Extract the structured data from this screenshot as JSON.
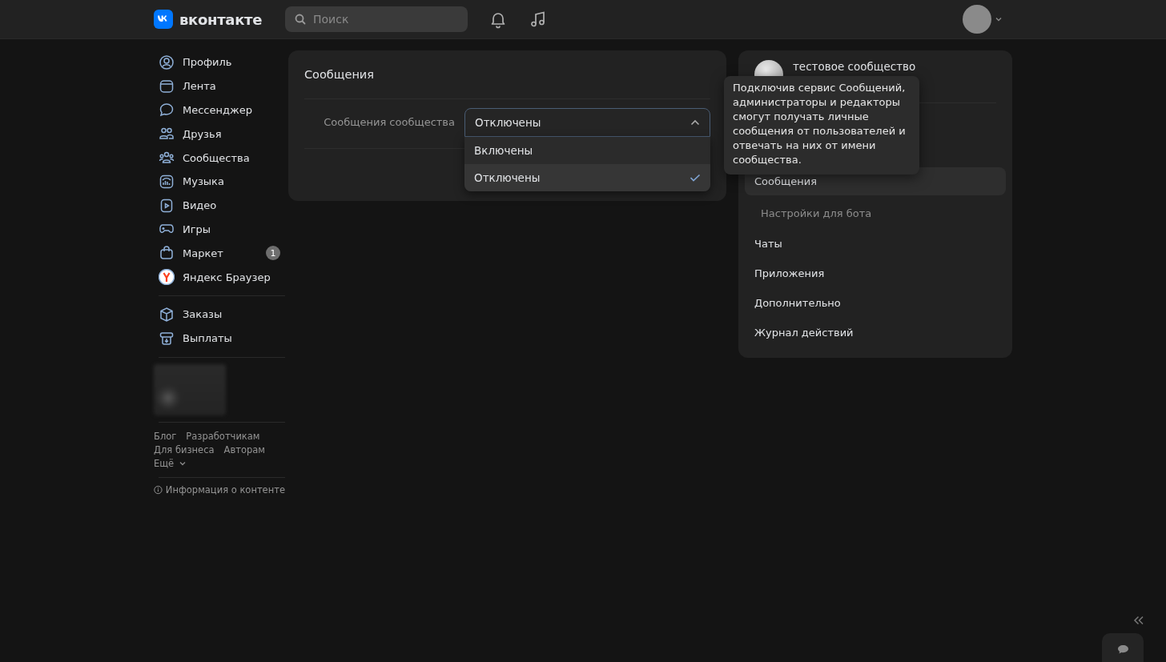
{
  "header": {
    "logo_text": "вконтакте",
    "search": {
      "placeholder": "Поиск"
    }
  },
  "sidebar": {
    "items": [
      {
        "label": "Профиль",
        "selected": false
      },
      {
        "label": "Лента",
        "selected": false
      },
      {
        "label": "Мессенджер",
        "selected": false
      },
      {
        "label": "Друзья",
        "selected": false
      },
      {
        "label": "Сообщества",
        "selected": false
      },
      {
        "label": "Музыка",
        "selected": false
      },
      {
        "label": "Видео",
        "selected": false
      },
      {
        "label": "Игры",
        "selected": false
      },
      {
        "label": "Маркет",
        "selected": false,
        "badge": "1"
      },
      {
        "label": "Яндекс Браузер",
        "selected": false
      }
    ],
    "extra_items": [
      {
        "label": "Заказы"
      },
      {
        "label": "Выплаты"
      }
    ],
    "footer_links": [
      [
        "Блог",
        "Разработчикам"
      ],
      [
        "Для бизнеса",
        "Авторам"
      ],
      [
        "Ещё"
      ]
    ],
    "content_info": "Информация о контенте"
  },
  "settings_card": {
    "title": "Сообщения",
    "field_label": "Сообщения сообщества",
    "select": {
      "value": "Отключены",
      "expanded": true,
      "options": [
        {
          "label": "Включены",
          "selected": false
        },
        {
          "label": "Отключены",
          "selected": true
        }
      ]
    }
  },
  "tooltip": "Подключив сервис Сообщений, администраторы и редакторы смогут получать личные сообщения от пользователей и отвечать на них от имени сообщества.",
  "right_panel": {
    "community_name": "тестовое сообщество",
    "menu": [
      {
        "label": "Сообщения",
        "selected": true,
        "children": [
          {
            "label": "Настройки для бота",
            "selected": false
          }
        ]
      },
      {
        "label": "Чаты",
        "selected": false
      },
      {
        "label": "Приложения",
        "selected": false
      },
      {
        "label": "Дополнительно",
        "selected": false
      },
      {
        "label": "Журнал действий",
        "selected": false
      }
    ]
  }
}
